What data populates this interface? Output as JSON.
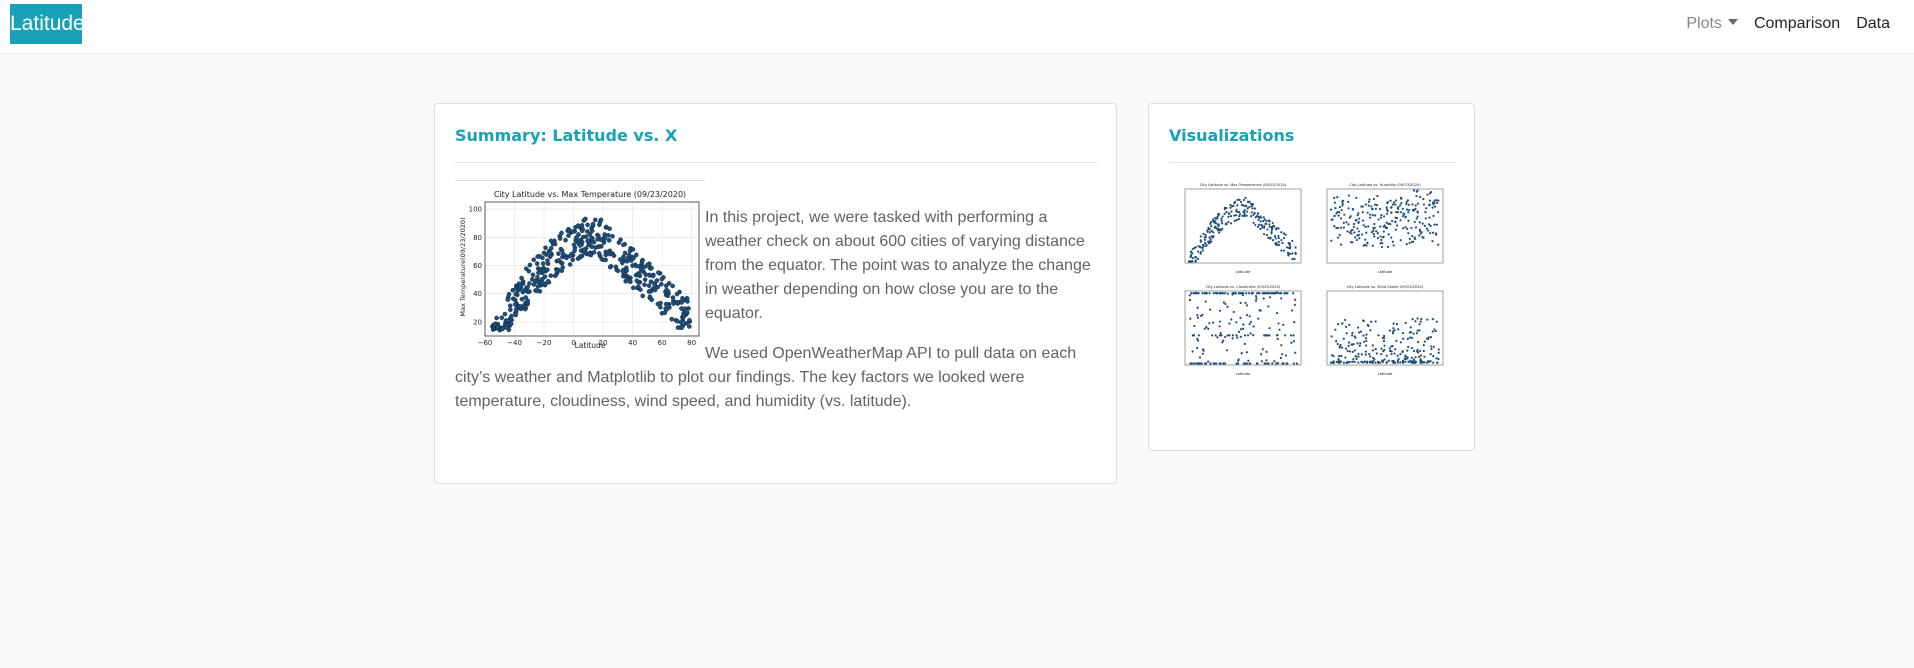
{
  "navbar": {
    "brand": "Latitude",
    "items": [
      {
        "label": "Plots",
        "dropdown": true
      },
      {
        "label": "Comparison"
      },
      {
        "label": "Data"
      }
    ]
  },
  "summary": {
    "title": "Summary: Latitude vs. X",
    "paragraph1": "In this project, we were tasked with performing a weather check on about 600 cities of varying distance from the equator. The point was to analyze the change in weather depending on how close you are to the equator.",
    "paragraph2": "We used OpenWeatherMap API to pull data on each city’s weather and Matplotlib to plot our findings. The key factors we looked were temperature, cloudiness, wind speed, and humidity (vs. latitude)."
  },
  "visualizations": {
    "title": "Visualizations"
  },
  "chart_data": {
    "type": "scatter",
    "title": "City Latitude vs. Max Temperature (09/23/2020)",
    "xlabel": "Latitude",
    "ylabel": "Max Temperature(09/23/2020)",
    "xlim": [
      -60,
      85
    ],
    "ylim": [
      10,
      105
    ],
    "xticks": [
      "−60",
      "−40",
      "−20",
      "0",
      "20",
      "40",
      "60",
      "80"
    ],
    "yticks": [
      "20",
      "40",
      "60",
      "80",
      "100"
    ],
    "grid": true,
    "point_color": "#1f4e79"
  },
  "thumbnails": [
    {
      "title": "City Latitude vs. Max Temperature (09/23/2020)",
      "xlabel": "Latitude"
    },
    {
      "title": "City Latitude vs. Humidity (09/23/2020)",
      "xlabel": "Latitude"
    },
    {
      "title": "City Latitude vs. Cloudiness (09/23/2020)",
      "xlabel": "Latitude"
    },
    {
      "title": "City Latitude vs. Wind Speed (09/23/2020)",
      "xlabel": "Latitude"
    }
  ],
  "colors": {
    "accent": "#17a2b8",
    "background": "#f8f9fa",
    "text_muted": "#5f6368"
  }
}
